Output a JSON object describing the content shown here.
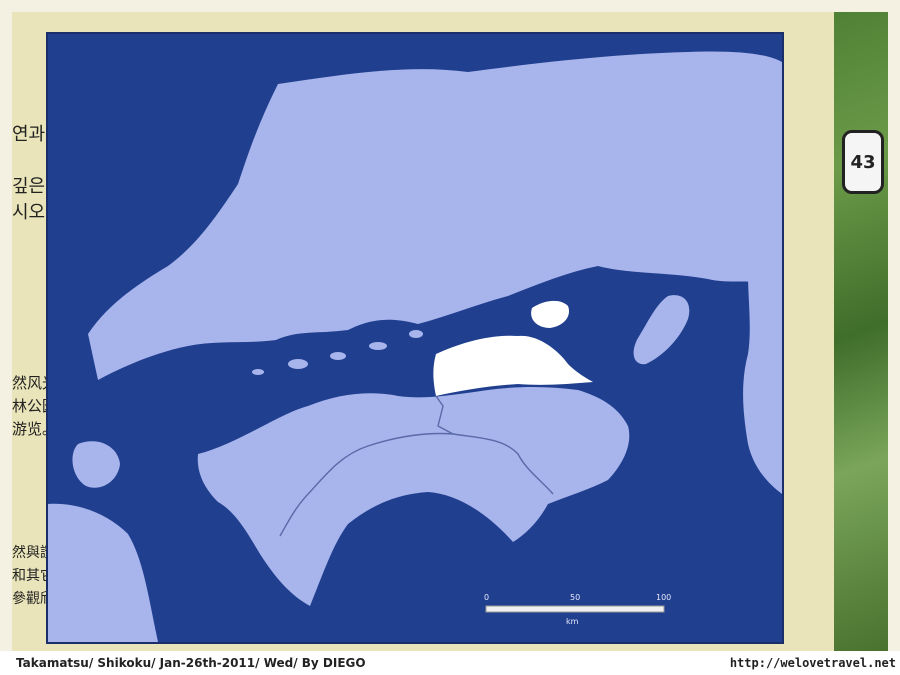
{
  "map": {
    "colors": {
      "sea": "#203f8f",
      "land": "#a8b4ec",
      "highlight": "#ffffff",
      "border_line": "#5a6aa8"
    },
    "highlighted_region": "Kagawa",
    "scale_bar": {
      "tick_0": "0",
      "tick_50": "50",
      "tick_100": "100",
      "unit": "km"
    }
  },
  "side_text": {
    "korean": [
      "연과",
      "",
      "깊은",
      "시오."
    ],
    "chinese_simplified": [
      "然风光,",
      "林公园",
      "游览。"
    ],
    "chinese_traditional": [
      "然與讚岐",
      "和其它具",
      "參觀欣賞。"
    ]
  },
  "route_sign": "43",
  "caption": {
    "left": "Takamatsu/ Shikoku/ Jan-26th-2011/ Wed/ By DIEGO",
    "right": "http://welovetravel.net"
  }
}
